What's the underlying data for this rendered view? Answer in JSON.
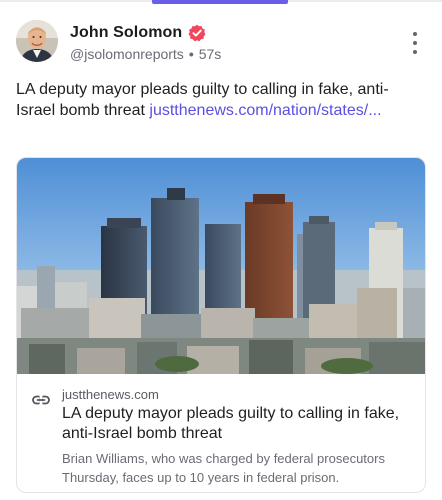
{
  "post": {
    "author_name": "John Solomon",
    "handle": "@jsolomonreports",
    "separator": "•",
    "time": "57s",
    "text": "LA deputy mayor pleads guilty to calling in fake, anti-Israel bomb threat ",
    "link_text": "justthenews.com/nation/states/..."
  },
  "link_card": {
    "domain": "justthenews.com",
    "title": "LA deputy mayor pleads guilty to calling in fake, anti-Israel bomb threat",
    "description": "Brian Williams, who was charged by federal prosecutors Thursday, faces up to 10 years in federal prison."
  },
  "icons": {
    "verified": "verified-badge-icon",
    "more": "more-vertical-icon",
    "link": "link-icon"
  },
  "colors": {
    "accent": "#6a5ee8",
    "link": "#5c4fe0",
    "verified_badge": "#f0475c"
  }
}
